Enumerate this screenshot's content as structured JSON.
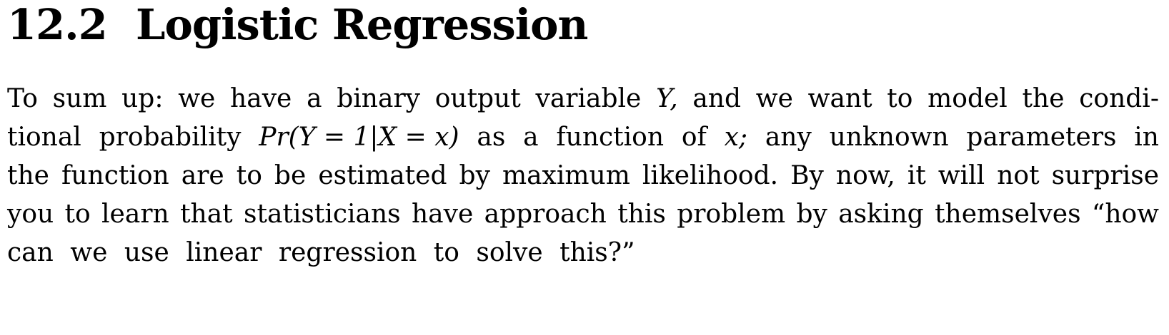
{
  "section": {
    "number": "12.2",
    "title": "Logistic Regression"
  },
  "paragraph": {
    "lines": [
      [
        "To",
        "sum",
        "up:",
        "we",
        "have",
        "a",
        "binary",
        "output",
        "variable",
        "Y,",
        "and",
        "we",
        "want",
        "to",
        "model",
        "the",
        "condi-"
      ],
      [
        "tional",
        "probability",
        "Pr(Y = 1|X = x)",
        "as",
        "a",
        "function",
        "of",
        "x;",
        "any",
        "unknown",
        "parameters",
        "in"
      ],
      [
        "the",
        "function",
        "are",
        "to",
        "be",
        "estimated",
        "by",
        "maximum",
        "likelihood.",
        "By",
        "now,",
        "it",
        "will",
        "not",
        "surprise"
      ],
      [
        "you",
        "to",
        "learn",
        "that",
        "statisticians",
        "have",
        "approach",
        "this",
        "problem",
        "by",
        "asking",
        "themselves",
        "“how"
      ],
      [
        "can",
        "we",
        "use",
        "linear",
        "regression",
        "to",
        "solve",
        "this?”"
      ]
    ]
  }
}
